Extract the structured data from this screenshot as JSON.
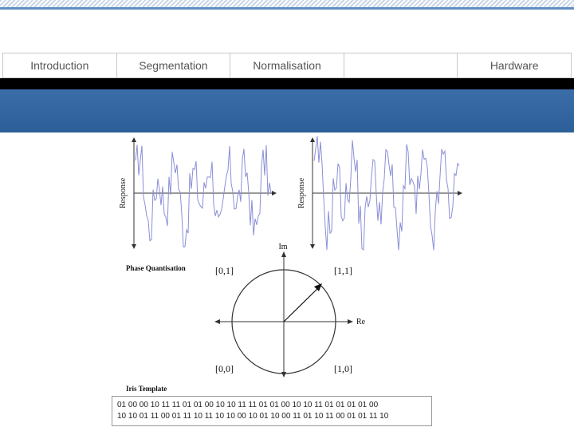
{
  "nav": {
    "tabs": [
      {
        "label": "Introduction"
      },
      {
        "label": "Segmentation"
      },
      {
        "label": "Normalisation"
      },
      {
        "label": ""
      },
      {
        "label": "Hardware"
      }
    ]
  },
  "colors": {
    "accent_band": "#2c5f99",
    "signal_line": "#8a8fd6"
  },
  "figure": {
    "response_label_left": "Response",
    "response_label_right": "Response",
    "phase_title": "Phase Quantisation",
    "axis_im": "Im",
    "axis_re": "Re",
    "quadrant_top_left": "[0,1]",
    "quadrant_top_right": "[1,1]",
    "quadrant_bottom_left": "[0,0]",
    "quadrant_bottom_right": "[1,0]",
    "template_title": "Iris Template",
    "template_line_1": "01 00 00 10 11 11 01 01 00 10 10 11 11 01 01 00 10 10 11 01 01 01 01 00",
    "template_line_2": "10 10 01 11 00 01 11 10 11 10 10 00 10 01 10 00 11 01 10 11 00 01 01 11 10"
  }
}
